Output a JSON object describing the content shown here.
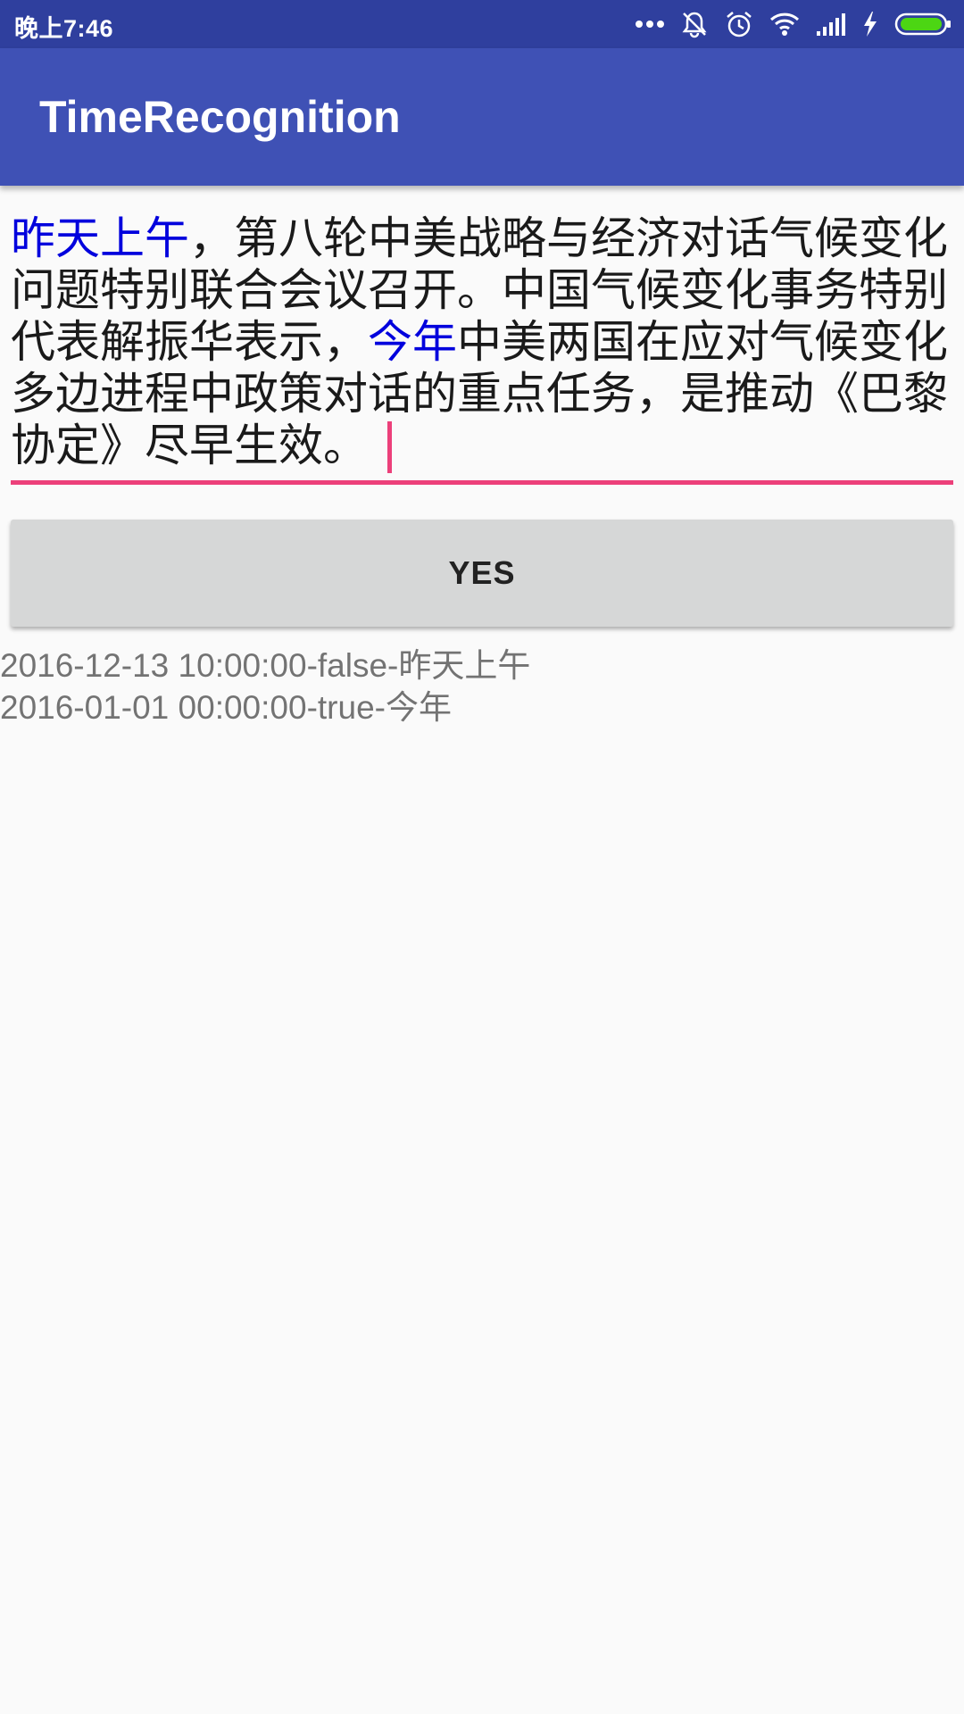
{
  "status_bar": {
    "time": "晚上7:46",
    "icons": [
      "more-dots-icon",
      "mute-bell-icon",
      "alarm-icon",
      "wifi-icon",
      "signal-icon",
      "charging-icon",
      "battery-icon"
    ],
    "colors": {
      "background": "#2f3f9e"
    }
  },
  "app_bar": {
    "title": "TimeRecognition",
    "colors": {
      "background": "#3f51b5"
    }
  },
  "input": {
    "segments": [
      {
        "text": "昨天上午",
        "highlight": true
      },
      {
        "text": "，第八轮中美战略与经济对话气候变化问题特别联合会议召开。中国气候变化事务特别代表解振华表示，",
        "highlight": false
      },
      {
        "text": "今年",
        "highlight": true
      },
      {
        "text": "中美两国在应对气候变化多边进程中政策对话的重点任务，是推动《巴黎协定》尽早生效。",
        "highlight": false
      }
    ],
    "colors": {
      "highlight": "#0000dd",
      "accent": "#ec407a"
    }
  },
  "button": {
    "label": "YES"
  },
  "results": [
    "2016-12-13 10:00:00-false-昨天上午",
    "2016-01-01 00:00:00-true-今年"
  ]
}
